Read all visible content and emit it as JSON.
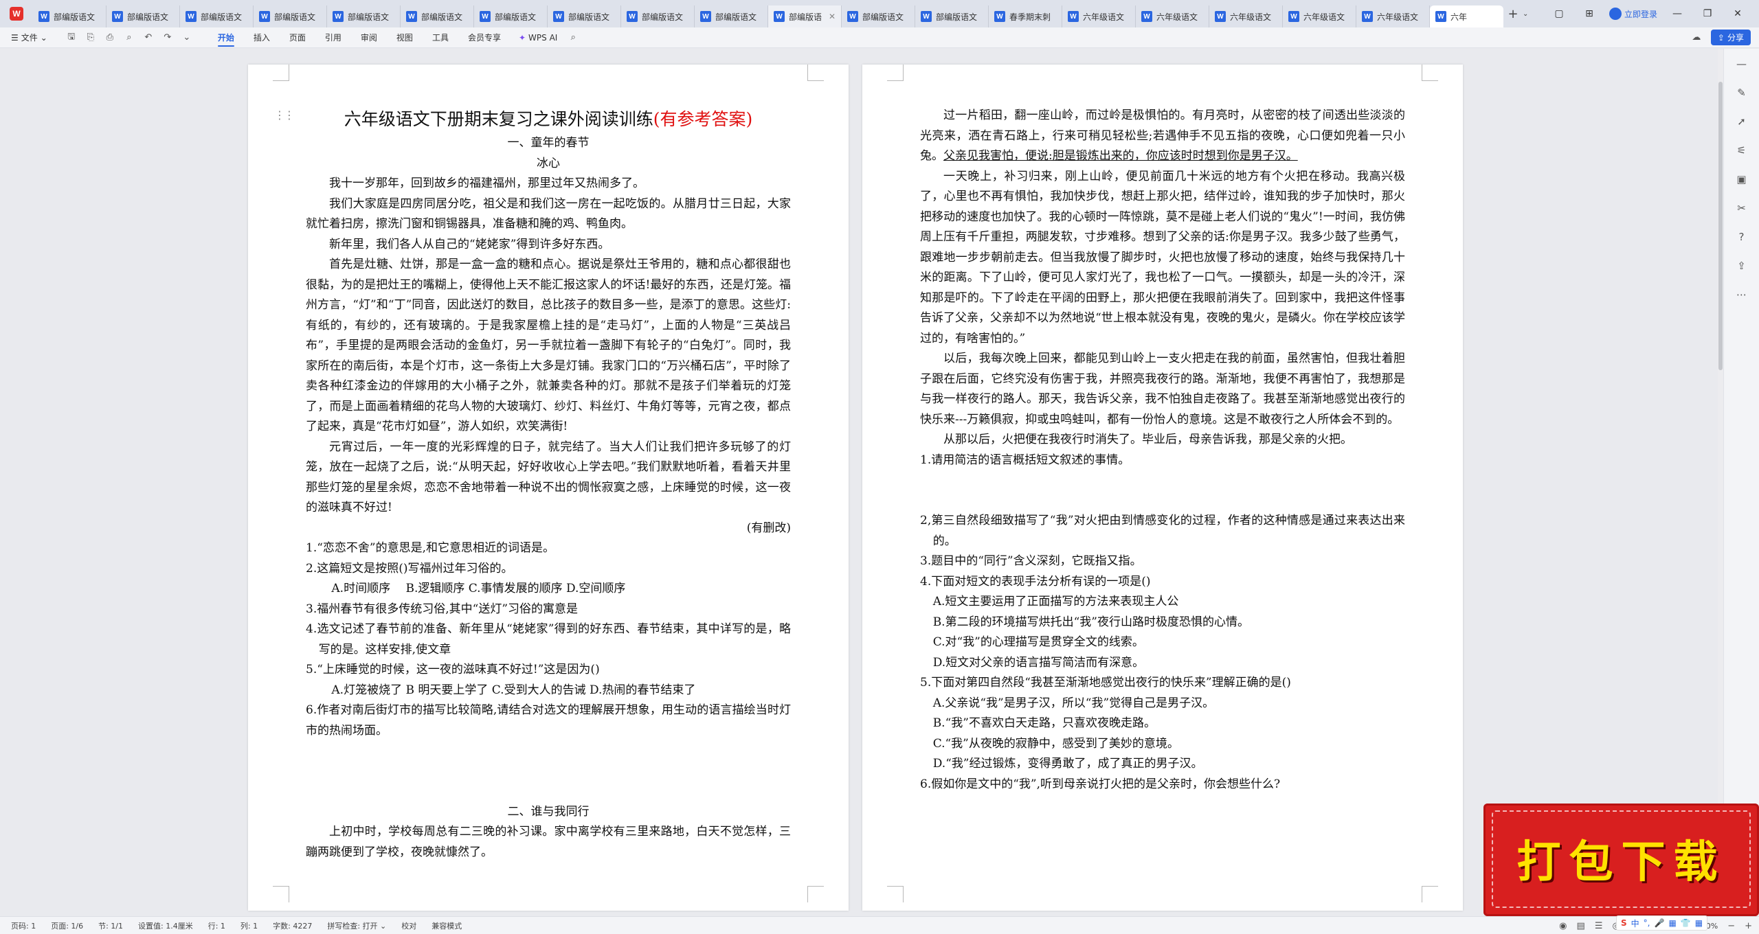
{
  "tabs": [
    {
      "label": "部编版语文"
    },
    {
      "label": "部编版语文"
    },
    {
      "label": "部编版语文"
    },
    {
      "label": "部编版语文"
    },
    {
      "label": "部编版语文"
    },
    {
      "label": "部编版语文"
    },
    {
      "label": "部编版语文"
    },
    {
      "label": "部编版语文"
    },
    {
      "label": "部编版语文"
    },
    {
      "label": "部编版语文"
    },
    {
      "label": "部编版语"
    },
    {
      "label": "部编版语文"
    },
    {
      "label": "部编版语文"
    },
    {
      "label": "春季期末刺"
    },
    {
      "label": "六年级语文"
    },
    {
      "label": "六年级语文"
    },
    {
      "label": "六年级语文"
    },
    {
      "label": "六年级语文"
    },
    {
      "label": "六年级语文"
    },
    {
      "label": "六年"
    }
  ],
  "tabbar": {
    "login": "立即登录"
  },
  "menubar": {
    "file": "文件",
    "tabs": [
      "开始",
      "插入",
      "页面",
      "引用",
      "审阅",
      "视图",
      "工具",
      "会员专享"
    ],
    "wps_ai": "WPS AI",
    "share": "分享"
  },
  "left_page": {
    "title_main": "六年级语文下册期末复习之课外阅读训练",
    "title_red": "(有参考答案)",
    "sec1": "一、童年的春节",
    "author": "冰心",
    "paras": [
      "我十一岁那年，回到故乡的福建福州，那里过年又热闹多了。",
      "我们大家庭是四房同居分吃，祖父是和我们这一房在一起吃饭的。从腊月廿三日起，大家就忙着扫房，擦洗门窗和铜锡器具，准备糖和腌的鸡、鸭鱼肉。",
      "新年里，我们各人从自己的“姥姥家”得到许多好东西。",
      "首先是灶糖、灶饼，那是一盒一盒的糖和点心。据说是祭灶王爷用的，糖和点心都很甜也很黏，为的是把灶王的嘴糊上，使得他上天不能汇报这家人的坏话!最好的东西，还是灯笼。福州方言，“灯”和“丁”同音，因此送灯的数目，总比孩子的数目多一些，是添丁的意思。这些灯:有纸的，有纱的，还有玻璃的。于是我家屋檐上挂的是“走马灯”，上面的人物是“三英战吕布”，手里提的是两眼会活动的金鱼灯，另一手就拉着一盏脚下有轮子的“白兔灯”。同时，我家所在的南后街，本是个灯市，这一条街上大多是灯铺。我家门口的“万兴桶石店”，平时除了卖各种红漆金边的伴嫁用的大小桶子之外，就兼卖各种的灯。那就不是孩子们举着玩的灯笼了，而是上面画着精细的花鸟人物的大玻璃灯、纱灯、料丝灯、牛角灯等等，元宵之夜，都点了起来，真是“花市灯如昼”，游人如织，欢笑满街!",
      "元宵过后，一年一度的光彩辉煌的日子，就完结了。当大人们让我们把许多玩够了的灯笼，放在一起烧了之后，说:“从明天起，好好收收心上学去吧。”我们默默地听着，看着天井里那些灯笼的星星余烬，恋恋不舍地带着一种说不出的惆怅寂寞之感，上床睡觉的时候，这一夜的滋味真不好过!"
    ],
    "note": "(有删改)",
    "q1": "1.“恋恋不舍”的意思是,和它意思相近的词语是。",
    "q2": "2.这篇短文是按照()写福州过年习俗的。",
    "q2_opts": "A.时间顺序　 B.逻辑顺序 C.事情发展的顺序 D.空间顺序",
    "q3": "3.福州春节有很多传统习俗,其中“送灯”习俗的寓意是",
    "q4": "4.选文记述了春节前的准备、新年里从“姥姥家”得到的好东西、春节结束，其中详写的是，略写的是。这样安排,使文章",
    "q5": "5.“上床睡觉的时候，这一夜的滋味真不好过!”这是因为()",
    "q5_opts": "A.灯笼被烧了 B 明天要上学了 C.受到大人的告诫 D.热闹的春节结束了",
    "q6": "6.作者对南后街灯市的描写比较简略,请结合对选文的理解展开想象，用生动的语言描绘当时灯市的热闹场面。",
    "sec2": "二、谁与我同行",
    "p2": "上初中时，学校每周总有二三晚的补习课。家中离学校有三里来路地，白天不觉怎样，三蹦两跳便到了学校，夜晚就慷然了。"
  },
  "right_page": {
    "p1a": "过一片稻田，翻一座山岭，而过岭是极惧怕的。有月亮时，从密密的枝了间透出些淡淡的光亮来，洒在青石路上，行来可稍见轻松些;若遇伸手不见五指的夜晚，心口便如兜着一只小兔。",
    "p1b": "父亲见我害怕，便说:胆是锻炼出来的，你应该时时想到你是男子汉。",
    "paras": [
      "一天晚上，补习归来，刚上山岭，便见前面几十米远的地方有个火把在移动。我高兴极了，心里也不再有惧怕，我加快步伐，想赶上那火把，结伴过岭，谁知我的步子加快时，那火把移动的速度也加快了。我的心顿时一阵惊跳，莫不是碰上老人们说的“鬼火”!一时间，我仿佛周上压有千斤重担，两腿发软，寸步难移。想到了父亲的话:你是男子汉。我多少鼓了些勇气，跟难地一步步朝前走去。但当我放慢了脚步时，火把也放慢了移动的速度，始终与我保持几十米的距离。下了山岭，便可见人家灯光了，我也松了一口气。一摸额头，却是一头的冷汗，深知那是吓的。下了岭走在平阔的田野上，那火把便在我眼前消失了。回到家中，我把这件怪事告诉了父亲，父亲却不以为然地说“世上根本就没有鬼，夜晚的鬼火，是磷火。你在学校应该学过的，有啥害怕的。”",
      "以后，我每次晚上回来，都能见到山岭上一支火把走在我的前面，虽然害怕，但我壮着胆子跟在后面，它终究没有伤害于我，并照亮我夜行的路。渐渐地，我便不再害怕了，我想那是与我一样夜行的路人。那天，我告诉父亲，我不怕独自走夜路了。我甚至渐渐地感觉出夜行的快乐来---万籁俱寂，抑或虫鸣蛙叫，都有一份怡人的意境。这是不敢夜行之人所体会不到的。",
      "从那以后，火把便在我夜行时消失了。毕业后，母亲告诉我，那是父亲的火把。"
    ],
    "q1": "1.请用简洁的语言概括短文叙述的事情。",
    "q2": "2,第三自然段细致描写了“我”对火把由到情感变化的过程，作者的这种情感是通过来表达出来的。",
    "q3": "3.题目中的“同行”含义深刻，它既指又指。",
    "q4": "4.下面对短文的表现手法分析有误的一项是()",
    "q4_opts": [
      "A.短文主要运用了正面描写的方法来表现主人公",
      "B.第二段的环境描写烘托出“我”夜行山路时极度恐惧的心情。",
      "C.对“我”的心理描写是贯穿全文的线索。",
      "D.短文对父亲的语言描写简洁而有深意。"
    ],
    "q5": "5.下面对第四自然段“我甚至渐渐地感觉出夜行的快乐来”理解正确的是()",
    "q5_opts": [
      "A.父亲说“我”是男子汉，所以“我”觉得自己是男子汉。",
      "B.“我”不喜欢白天走路，只喜欢夜晚走路。",
      "C.“我”从夜晚的寂静中，感受到了美妙的意境。",
      "D.“我”经过锻炼，变得勇敢了，成了真正的男子汉。"
    ],
    "q6": "6.假如你是文中的“我”,听到母亲说打火把的是父亲时，你会想些什么?"
  },
  "banner": {
    "text": "打包下载"
  },
  "statusbar": {
    "items": [
      "页码: 1",
      "页面: 1/6",
      "节: 1/1",
      "设置值: 1.4厘米",
      "行: 1",
      "列: 1",
      "字数: 4227",
      "拼写检查: 打开 ⌄",
      "校对",
      "兼容模式"
    ],
    "zoom": "110%"
  },
  "ime": {
    "items": [
      "中",
      "°,",
      "🎤",
      "▦",
      "👕",
      "▦"
    ]
  }
}
